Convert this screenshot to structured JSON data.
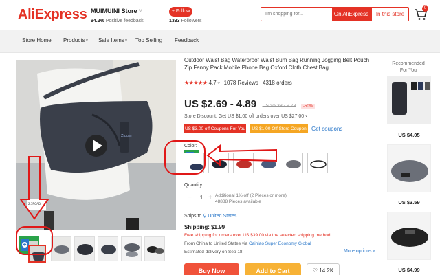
{
  "header": {
    "logo": "AliExpress",
    "store_name": "MUIMUINI Store",
    "positive_feedback": "94.2%",
    "positive_feedback_label": "Positive feedback",
    "follow_label": "+ Follow",
    "followers_count": "1333",
    "followers_label": "Followers",
    "search_placeholder": "I'm shopping for...",
    "search_ali_label": "On AliExpress",
    "search_store_label": "In this store",
    "cart_count": "0"
  },
  "nav": {
    "items": [
      "Store Home",
      "Products",
      "Sale Items",
      "Top Selling",
      "Feedback"
    ]
  },
  "product": {
    "title": "Outdoor Waist Bag Waterproof Waist Bum Bag Running Jogging Belt Pouch Zip Fanny Pack Mobile Phone Bag Oxford Cloth Chest Bag",
    "rating": "4.7",
    "reviews": "1078 Reviews",
    "orders": "4318 orders",
    "price": "US $2.69 - 4.89",
    "old_price": "US $5.38 - 9.78",
    "discount": "-50%",
    "store_discount": "Store Discount: Get US $1.00 off orders over US $27.00",
    "coupon1": "US $3.00 off Coupons For You",
    "coupon2": "US $1.00 Off Store Coupon",
    "get_coupons": "Get coupons",
    "color_label": "Color:",
    "quantity_label": "Quantity:",
    "quantity_value": "1",
    "qty_note_1": "Additional 1% off (2 Pieces or more)",
    "qty_note_2": "48888 Pieces available",
    "ships_to_label": "Ships to",
    "ships_to_dest": "United States",
    "shipping": "Shipping: $1.99",
    "ship_free": "Free shipping for orders over US $39.00 via the selected shipping method",
    "ship_from_prefix": "From China to United States via",
    "ship_from_carrier": "Cainiao Super Economy Global",
    "delivery": "Estimated delivery on Sep 18",
    "more_options": "More options",
    "buy_now": "Buy Now",
    "add_to_cart": "Add to Cart",
    "wishlist": "14.2K"
  },
  "recommended": {
    "title": "Recommended For You",
    "prices": [
      "US $4.05",
      "US $3.59",
      "US $4.99"
    ]
  },
  "colors": {
    "brand": "#e43225",
    "orange": "#f5a623",
    "link": "#2a77c9",
    "bag_dark": "#3a3f4a"
  }
}
